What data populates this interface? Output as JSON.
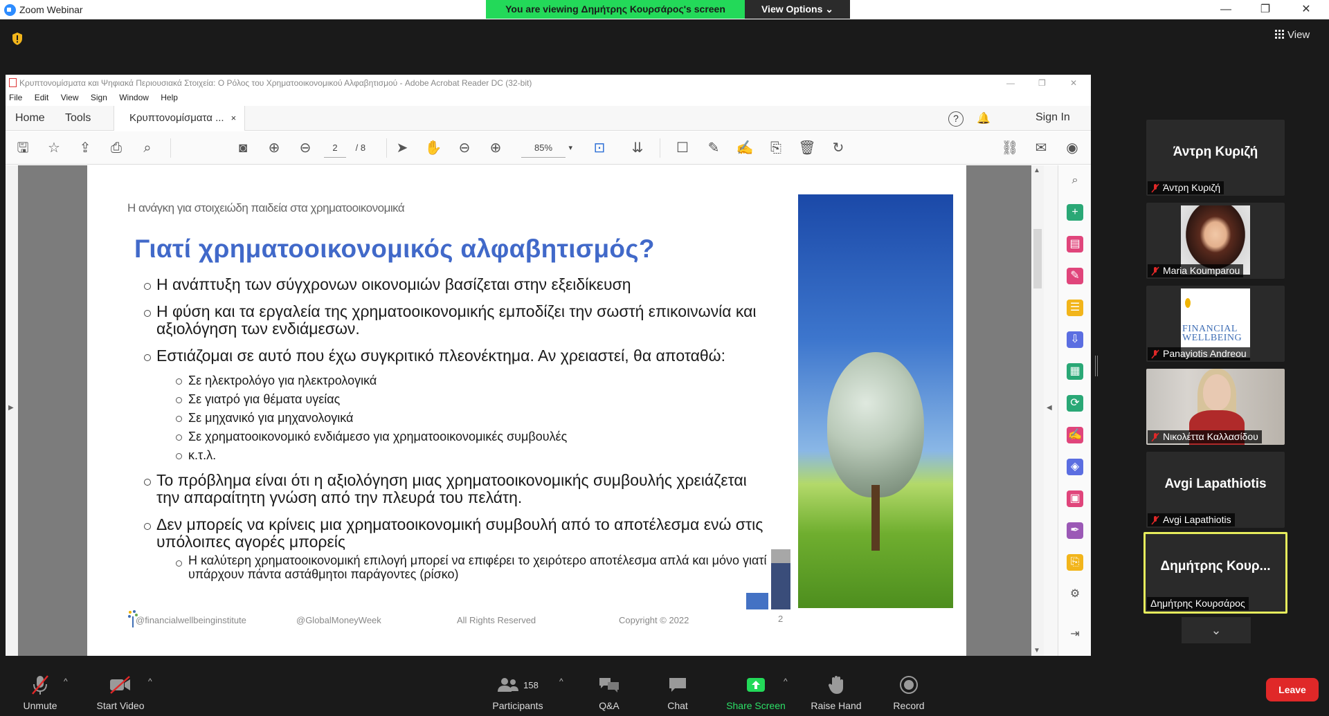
{
  "window": {
    "app_title": "Zoom Webinar",
    "minimize": "—",
    "restore": "❐",
    "close": "✕"
  },
  "banner": {
    "viewing_text": "You are viewing Δημήτρης Κουρσάρος's screen",
    "view_options": "View Options ⌄"
  },
  "view_button": "View",
  "acrobat": {
    "title": "Κρυπτονομίσματα και Ψηφιακά Περιουσιακά Στοιχεία: Ο Ρόλος του Χρηματοοικονομικού Αλφαβητισμού - Adobe Acrobat Reader DC (32-bit)",
    "menu": [
      "File",
      "Edit",
      "View",
      "Sign",
      "Window",
      "Help"
    ],
    "tabs": {
      "home": "Home",
      "tools": "Tools",
      "doc": "Κρυπτονομίσματα ...",
      "close": "×"
    },
    "help": "?",
    "sign_in": "Sign In",
    "page_current": "2",
    "page_total": "/ 8",
    "zoom": "85%"
  },
  "slide": {
    "subtitle": "Η ανάγκη για στοιχειώδη παιδεία στα χρηματοοικονομικά",
    "title": "Γιατί χρηματοοικονομικός αλφαβητισμός?",
    "bullets": [
      "Η ανάπτυξη των σύγχρονων οικονομιών βασίζεται στην εξειδίκευση",
      "Η φύση και τα εργαλεία της χρηματοοικονομικής εμποδίζει την σωστή επικοινωνία και αξιολόγηση των ενδιάμεσων.",
      "Εστιάζομαι σε αυτό που έχω συγκριτικό πλεονέκτημα. Αν χρειαστεί, θα αποταθώ:",
      "Το πρόβλημα είναι ότι η αξιολόγηση μιας χρηματοοικονομικής συμβουλής χρειάζεται την απαραίτητη γνώση από την πλευρά του πελάτη.",
      "Δεν μπορείς να κρίνεις μια χρηματοοικονομική συμβουλή από το αποτέλεσμα ενώ στις υπόλοιπες αγορές μπορείς"
    ],
    "sub_bullets_3": [
      "Σε ηλεκτρολόγο για ηλεκτρολογικά",
      "Σε γιατρό για θέματα υγείας",
      "Σε μηχανικό για μηχανολογικά",
      "Σε χρηματοοικονομικό ενδιάμεσο για χρηματοοικονομικές συμβουλές",
      "κ.τ.λ."
    ],
    "sub_bullet_5": "Η καλύτερη χρηματοοικονομική επιλογή μπορεί να επιφέρει το χειρότερο αποτέλεσμα απλά και μόνο γιατί υπάρχουν πάντα αστάθμητοι παράγοντες (ρίσκο)",
    "footer": {
      "handle": "@financialwellbeinginstitute",
      "gmw": "@GlobalMoneyWeek",
      "rights": "All Rights Reserved",
      "copyright": "Copyright © 2022",
      "page": "2"
    }
  },
  "participants": [
    {
      "name": "Άντρη Κυριζή",
      "big_name": "Άντρη Κυριζή",
      "kind": "name"
    },
    {
      "name": "Maria Koumparou",
      "kind": "photo"
    },
    {
      "name": "Panayiotis Andreou",
      "kind": "logo",
      "logo_text": "FINANCIAL WELLBEING"
    },
    {
      "name": "Νικολέττα Καλλασίδου",
      "kind": "photo"
    },
    {
      "name": "Avgi Lapathiotis",
      "big_name": "Avgi Lapathiotis",
      "kind": "name"
    },
    {
      "name": "Δημήτρης Κουρσάρος",
      "big_name": "Δημήτρης Κουρ...",
      "kind": "name",
      "active": true
    }
  ],
  "bottombar": {
    "unmute": "Unmute",
    "start_video": "Start Video",
    "participants": "Participants",
    "participants_count": "158",
    "qa": "Q&A",
    "chat": "Chat",
    "share_screen": "Share Screen",
    "raise_hand": "Raise Hand",
    "record": "Record",
    "leave": "Leave"
  },
  "colors": {
    "share_green": "#23d959",
    "title_blue": "#4169c9",
    "leave_red": "#e02828",
    "active_speaker": "#e6ec5c"
  }
}
